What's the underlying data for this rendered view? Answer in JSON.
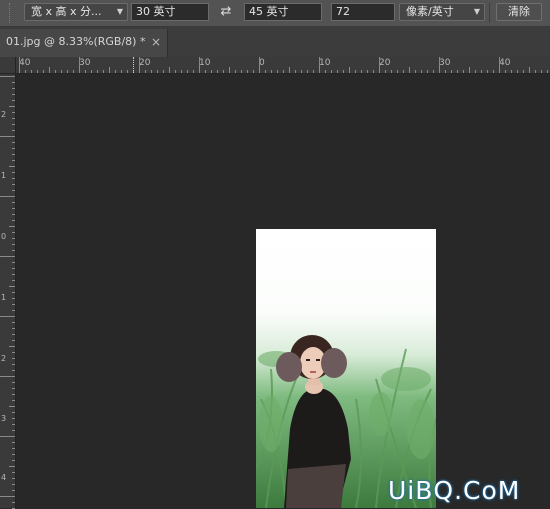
{
  "options_bar": {
    "ratio_select": "宽 x 高 x 分...",
    "width_value": "30 英寸",
    "height_value": "45 英寸",
    "resolution_value": "72",
    "unit_select": "像素/英寸",
    "clear_button": "清除",
    "swap_icon": "swap-arrows-icon"
  },
  "document_tab": {
    "title": "01.jpg @ 8.33%(RGB/8) *",
    "close_glyph": "×"
  },
  "ruler_top": {
    "labels": [
      "40",
      "30",
      "20",
      "10",
      "0",
      "10",
      "20",
      "30",
      "40"
    ]
  },
  "ruler_left": {
    "labels": [
      "2",
      "1",
      "0",
      "1",
      "2",
      "3",
      "4"
    ]
  },
  "watermark": {
    "text": "UiBQ.CoM"
  }
}
